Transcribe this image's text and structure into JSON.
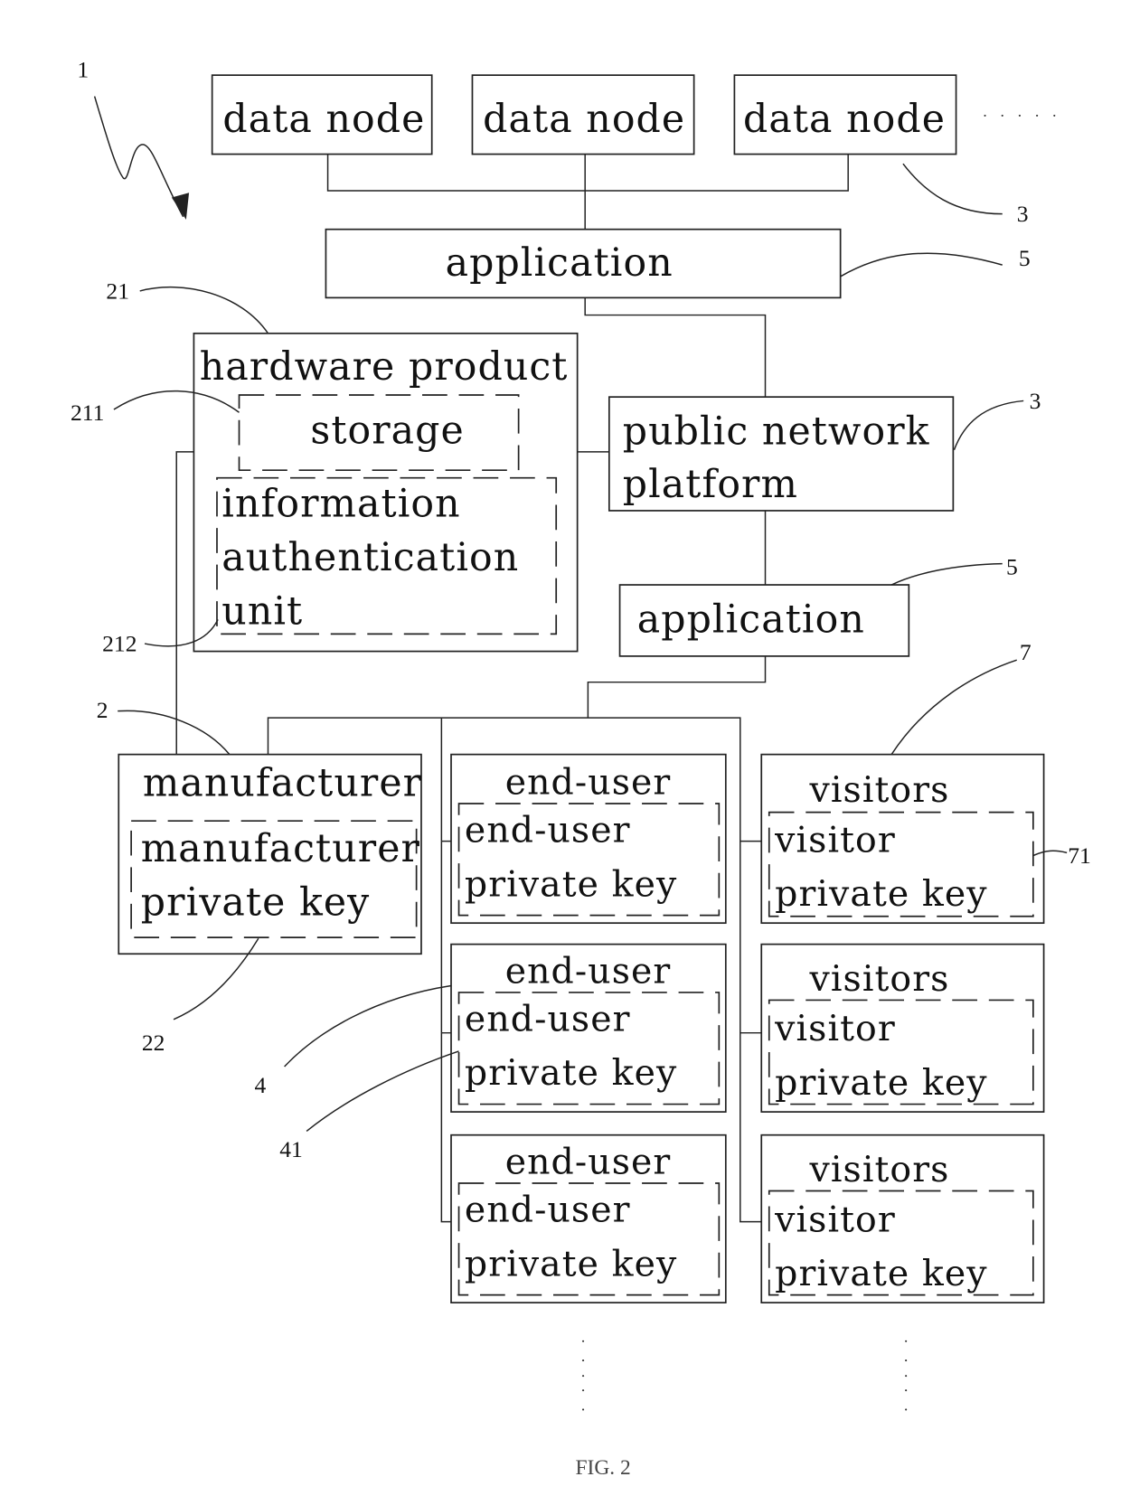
{
  "figure": {
    "caption": "FIG. 2",
    "system_ref": "1"
  },
  "data_nodes": [
    {
      "label": "data node"
    },
    {
      "label": "data node"
    },
    {
      "label": "data node"
    }
  ],
  "data_nodes_ref": "3",
  "top_application": {
    "label": "application",
    "ref": "5"
  },
  "hardware_product": {
    "label": "hardware product",
    "ref": "21",
    "storage": {
      "label": "storage",
      "ref": "211"
    },
    "auth_unit": {
      "lines": [
        "information",
        "authentication",
        "unit"
      ],
      "ref": "212"
    }
  },
  "public_network": {
    "lines": [
      "public network",
      "platform"
    ],
    "ref": "3"
  },
  "mid_application": {
    "label": "application",
    "ref": "5"
  },
  "manufacturer": {
    "label": "manufacturer",
    "ref": "2",
    "key": {
      "lines": [
        "manufacturer",
        "private key"
      ],
      "ref": "22"
    }
  },
  "end_users": [
    {
      "label": "end-user",
      "key_lines": [
        "end-user",
        "private key"
      ]
    },
    {
      "label": "end-user",
      "key_lines": [
        "end-user",
        "private key"
      ]
    },
    {
      "label": "end-user",
      "key_lines": [
        "end-user",
        "private key"
      ]
    }
  ],
  "end_user_ref": "4",
  "end_user_key_ref": "41",
  "visitors": [
    {
      "label": "visitors",
      "key_lines": [
        "visitor",
        "private key"
      ]
    },
    {
      "label": "visitors",
      "key_lines": [
        "visitor",
        "private key"
      ]
    },
    {
      "label": "visitors",
      "key_lines": [
        "visitor",
        "private key"
      ]
    }
  ],
  "visitors_ref": "7",
  "visitor_key_ref": "71"
}
